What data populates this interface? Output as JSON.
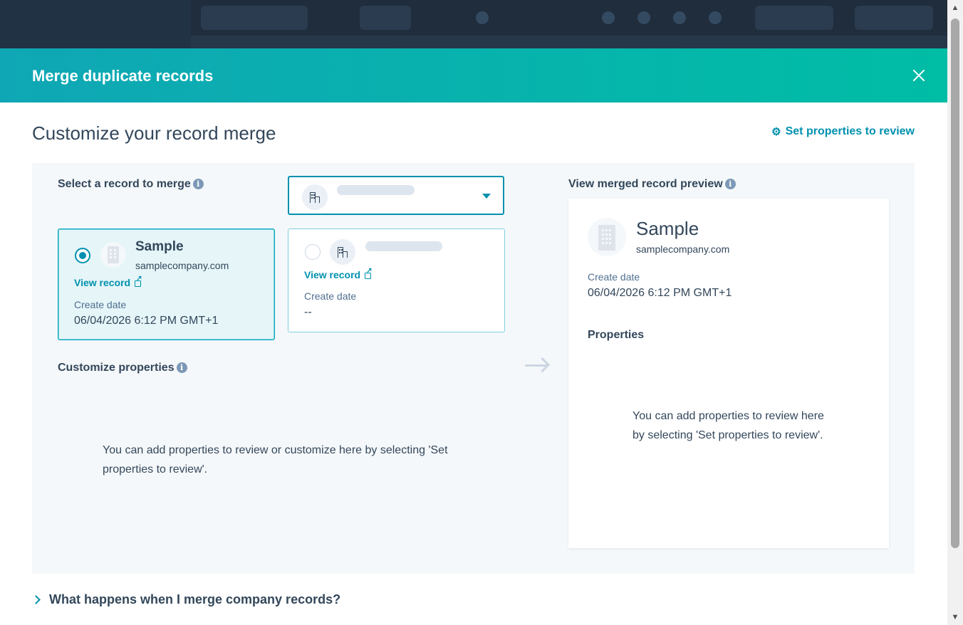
{
  "modal": {
    "title": "Merge duplicate records",
    "section_title": "Customize your record merge",
    "set_properties_link": "Set properties to review"
  },
  "select_record": {
    "label": "Select a record to merge"
  },
  "primary_record": {
    "name": "Sample",
    "domain": "samplecompany.com",
    "view_link": "View record",
    "create_date_label": "Create date",
    "create_date_value": "06/04/2026 6:12 PM GMT+1",
    "selected": true
  },
  "secondary_record": {
    "view_link": "View record",
    "create_date_label": "Create date",
    "create_date_value": "--",
    "selected": false
  },
  "customize": {
    "label": "Customize properties",
    "empty_message": "You can add properties to review or customize here by selecting 'Set properties to review'."
  },
  "preview": {
    "label": "View merged record preview",
    "name": "Sample",
    "domain": "samplecompany.com",
    "create_date_label": "Create date",
    "create_date_value": "06/04/2026 6:12 PM GMT+1",
    "properties_title": "Properties",
    "empty_message": "You can add properties to review here by selecting 'Set properties to review'."
  },
  "faq": {
    "label": "What happens when I merge company records?"
  },
  "icons": {
    "close": "close-icon",
    "gear": "gear-icon",
    "info": "info-icon",
    "company": "company-icon",
    "external_link": "external-link-icon",
    "arrow": "arrow-right-icon",
    "chevron": "chevron-right-icon"
  },
  "colors": {
    "header_gradient_start": "#0fa7b5",
    "header_gradient_end": "#00bda5",
    "accent": "#0091ae",
    "text": "#33475b",
    "panel_bg": "#f5f8fa"
  }
}
